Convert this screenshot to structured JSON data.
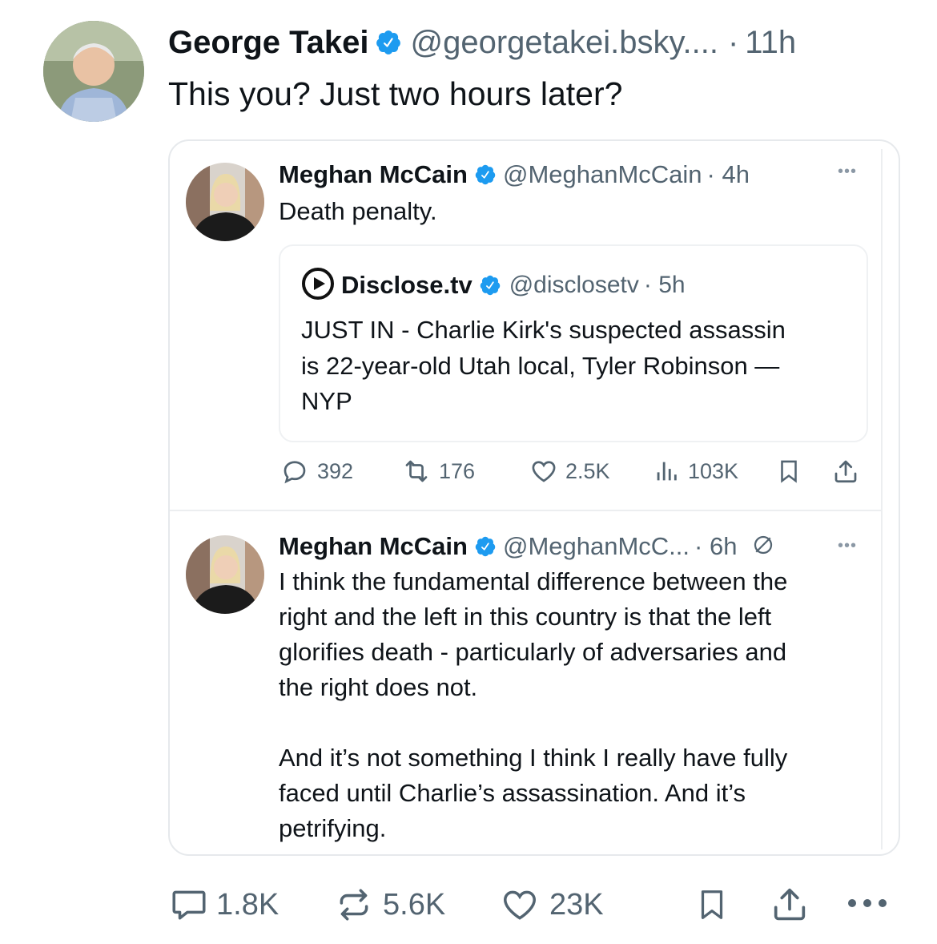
{
  "post": {
    "author": "George Takei",
    "handle": "@georgetakei.bsky....",
    "separator": "·",
    "time": "11h",
    "text": "This you? Just two hours later?",
    "stats": {
      "replies": "1.8K",
      "reposts": "5.6K",
      "likes": "23K"
    }
  },
  "screenshot": {
    "tweet1": {
      "author": "Meghan McCain",
      "handle": "@MeghanMcCain",
      "time": "· 4h",
      "text": "Death penalty.",
      "quote": {
        "author": "Disclose.tv",
        "handle": "@disclosetv",
        "time": "· 5h",
        "lines": [
          "JUST IN - Charlie Kirk's suspected assassin",
          "is 22-year-old Utah local, Tyler Robinson —",
          "NYP"
        ]
      },
      "stats": {
        "replies": "392",
        "reposts": "176",
        "likes": "2.5K",
        "views": "103K"
      }
    },
    "tweet2": {
      "author": "Meghan McCain",
      "handle": "@MeghanMcC...",
      "time": "· 6h",
      "para1": [
        "I think the fundamental difference between the",
        "right and the left in this country is that the left",
        "glorifies death - particularly of adversaries and",
        "the right does not."
      ],
      "para2": [
        "And it’s not something I think I really have fully",
        "faced until Charlie’s assassination. And it’s",
        "petrifying."
      ]
    }
  },
  "colors": {
    "verified": "#1d9bf0",
    "muted": "#536471",
    "text": "#0f1419",
    "border": "#e6e9ec"
  }
}
